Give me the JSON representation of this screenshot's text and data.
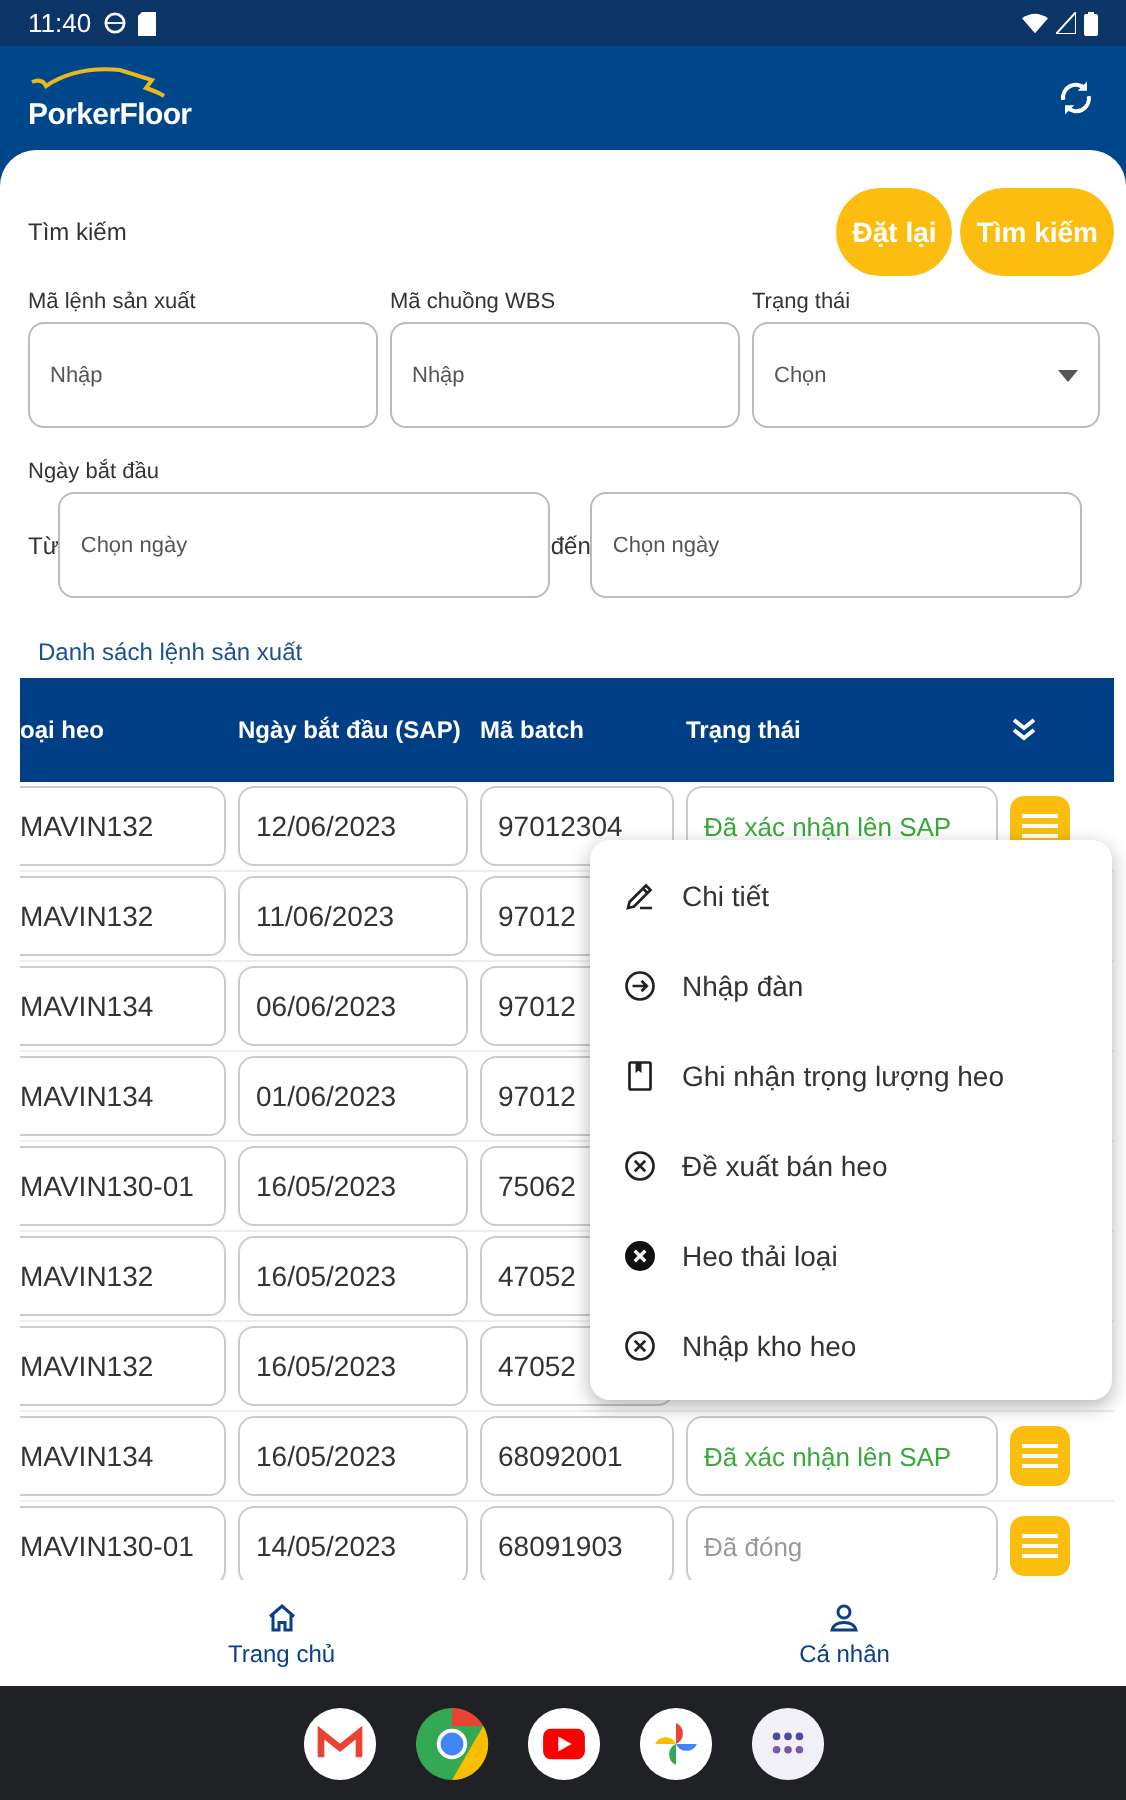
{
  "status_bar": {
    "time": "11:40"
  },
  "app_bar": {
    "logo": "PorkerFloor"
  },
  "search": {
    "title": "Tìm kiếm",
    "buttons": [
      "Đặt lại",
      "Tìm kiếm"
    ],
    "fields": [
      {
        "label": "Mã lệnh sản xuất",
        "placeholder": "Nhập",
        "kind": "text"
      },
      {
        "label": "Mã chuồng WBS",
        "placeholder": "Nhập",
        "kind": "text"
      },
      {
        "label": "Trạng thái",
        "placeholder": "Chọn",
        "kind": "select"
      }
    ],
    "date": {
      "label": "Ngày bắt đầu",
      "from_label": "Từ",
      "from_placeholder": "Chọn ngày",
      "to_label": "đến",
      "to_placeholder": "Chọn ngày"
    }
  },
  "list_title": "Danh sách lệnh sản xuất",
  "table": {
    "columns": [
      "oại heo",
      "Ngày bắt đầu (SAP)",
      "Mã batch",
      "Trạng thái"
    ],
    "rows": [
      {
        "cells": [
          "MAVIN132",
          "12/06/2023",
          "97012304"
        ],
        "status": "Đã xác nhận lên SAP",
        "kind": "confirmed"
      },
      {
        "cells": [
          "MAVIN132",
          "11/06/2023",
          "97012"
        ]
      },
      {
        "cells": [
          "MAVIN134",
          "06/06/2023",
          "97012"
        ]
      },
      {
        "cells": [
          "MAVIN134",
          "01/06/2023",
          "97012"
        ]
      },
      {
        "cells": [
          "MAVIN130-01",
          "16/05/2023",
          "75062"
        ]
      },
      {
        "cells": [
          "MAVIN132",
          "16/05/2023",
          "47052"
        ]
      },
      {
        "cells": [
          "MAVIN132",
          "16/05/2023",
          "47052"
        ]
      },
      {
        "cells": [
          "MAVIN134",
          "16/05/2023",
          "68092001"
        ],
        "status": "Đã xác nhận lên SAP",
        "kind": "confirmed"
      },
      {
        "cells": [
          "MAVIN130-01",
          "14/05/2023",
          "68091903"
        ],
        "status": "Đã đóng",
        "kind": "closed"
      }
    ]
  },
  "menu": [
    {
      "label": "Chi tiết",
      "kind": "edit"
    },
    {
      "label": "Nhập đàn",
      "kind": "enter"
    },
    {
      "label": "Ghi nhận trọng lượng heo",
      "kind": "save"
    },
    {
      "label": "Đề xuất bán heo",
      "kind": "cancel"
    },
    {
      "label": "Heo thải loại",
      "kind": "cancel_filled"
    },
    {
      "label": "Nhập kho heo",
      "kind": "cancel"
    }
  ],
  "bottom_nav": [
    {
      "label": "Trang chủ",
      "kind": "home"
    },
    {
      "label": "Cá nhân",
      "kind": "person"
    }
  ]
}
